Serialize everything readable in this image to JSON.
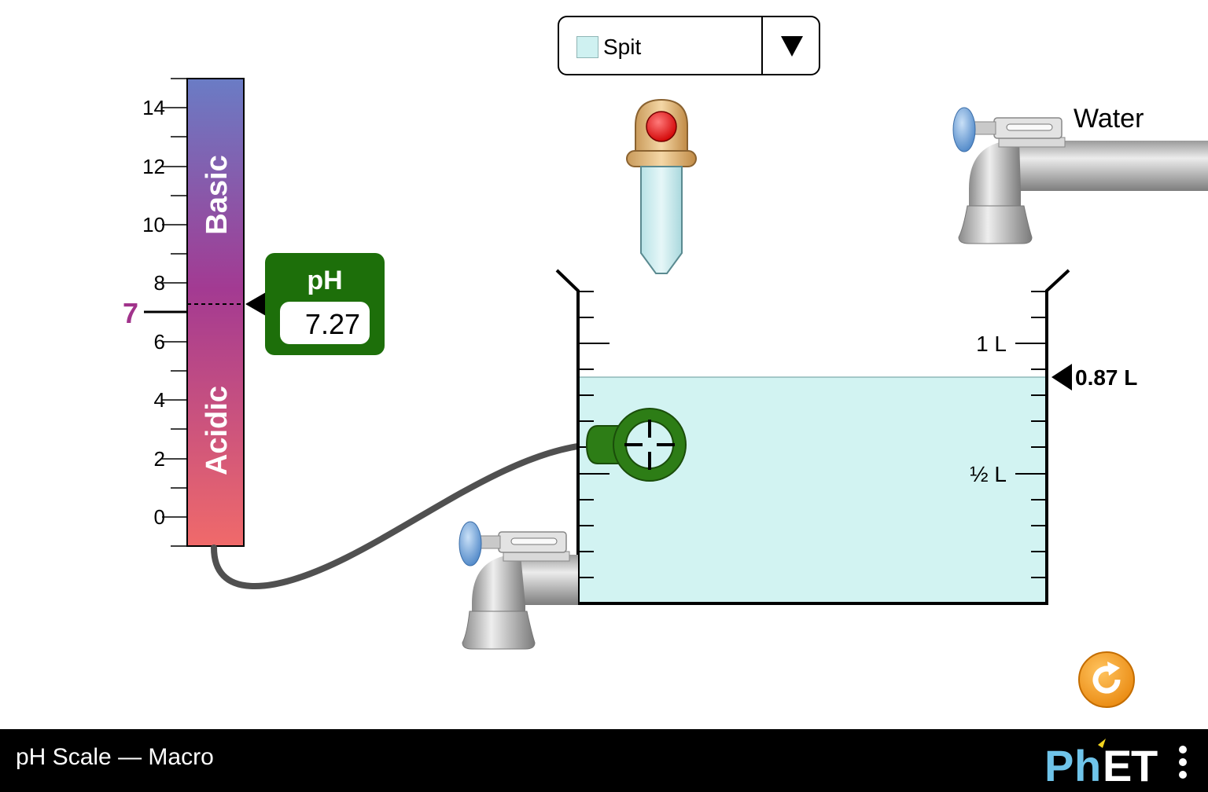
{
  "app": {
    "title": "pH Scale — Macro"
  },
  "solute_selector": {
    "selected": "Spit",
    "swatch_color": "#cff1f1"
  },
  "ph_scale": {
    "ticks": [
      "14",
      "12",
      "10",
      "8",
      "6",
      "4",
      "2",
      "0"
    ],
    "neutral_label": "7",
    "basic_label": "Basic",
    "acidic_label": "Acidic"
  },
  "ph_meter": {
    "title": "pH",
    "value": "7.27"
  },
  "water_faucet": {
    "label": "Water"
  },
  "beaker": {
    "label_1L": "1 L",
    "label_half": "½ L",
    "volume_readout": "0.87 L",
    "volume_liters": 0.87,
    "max_liters": 1.2,
    "solution_color": "#d2f3f2"
  },
  "colors": {
    "meter_green": "#1d6f0a",
    "neutral_purple": "#a1338b",
    "reset_orange": "#f39a17"
  },
  "icons": {
    "dropper": "dropper-icon",
    "faucet": "faucet-icon",
    "probe": "ph-probe-icon",
    "reset": "reset-icon",
    "logo": "phet-logo",
    "menu": "kebab-menu-icon"
  }
}
